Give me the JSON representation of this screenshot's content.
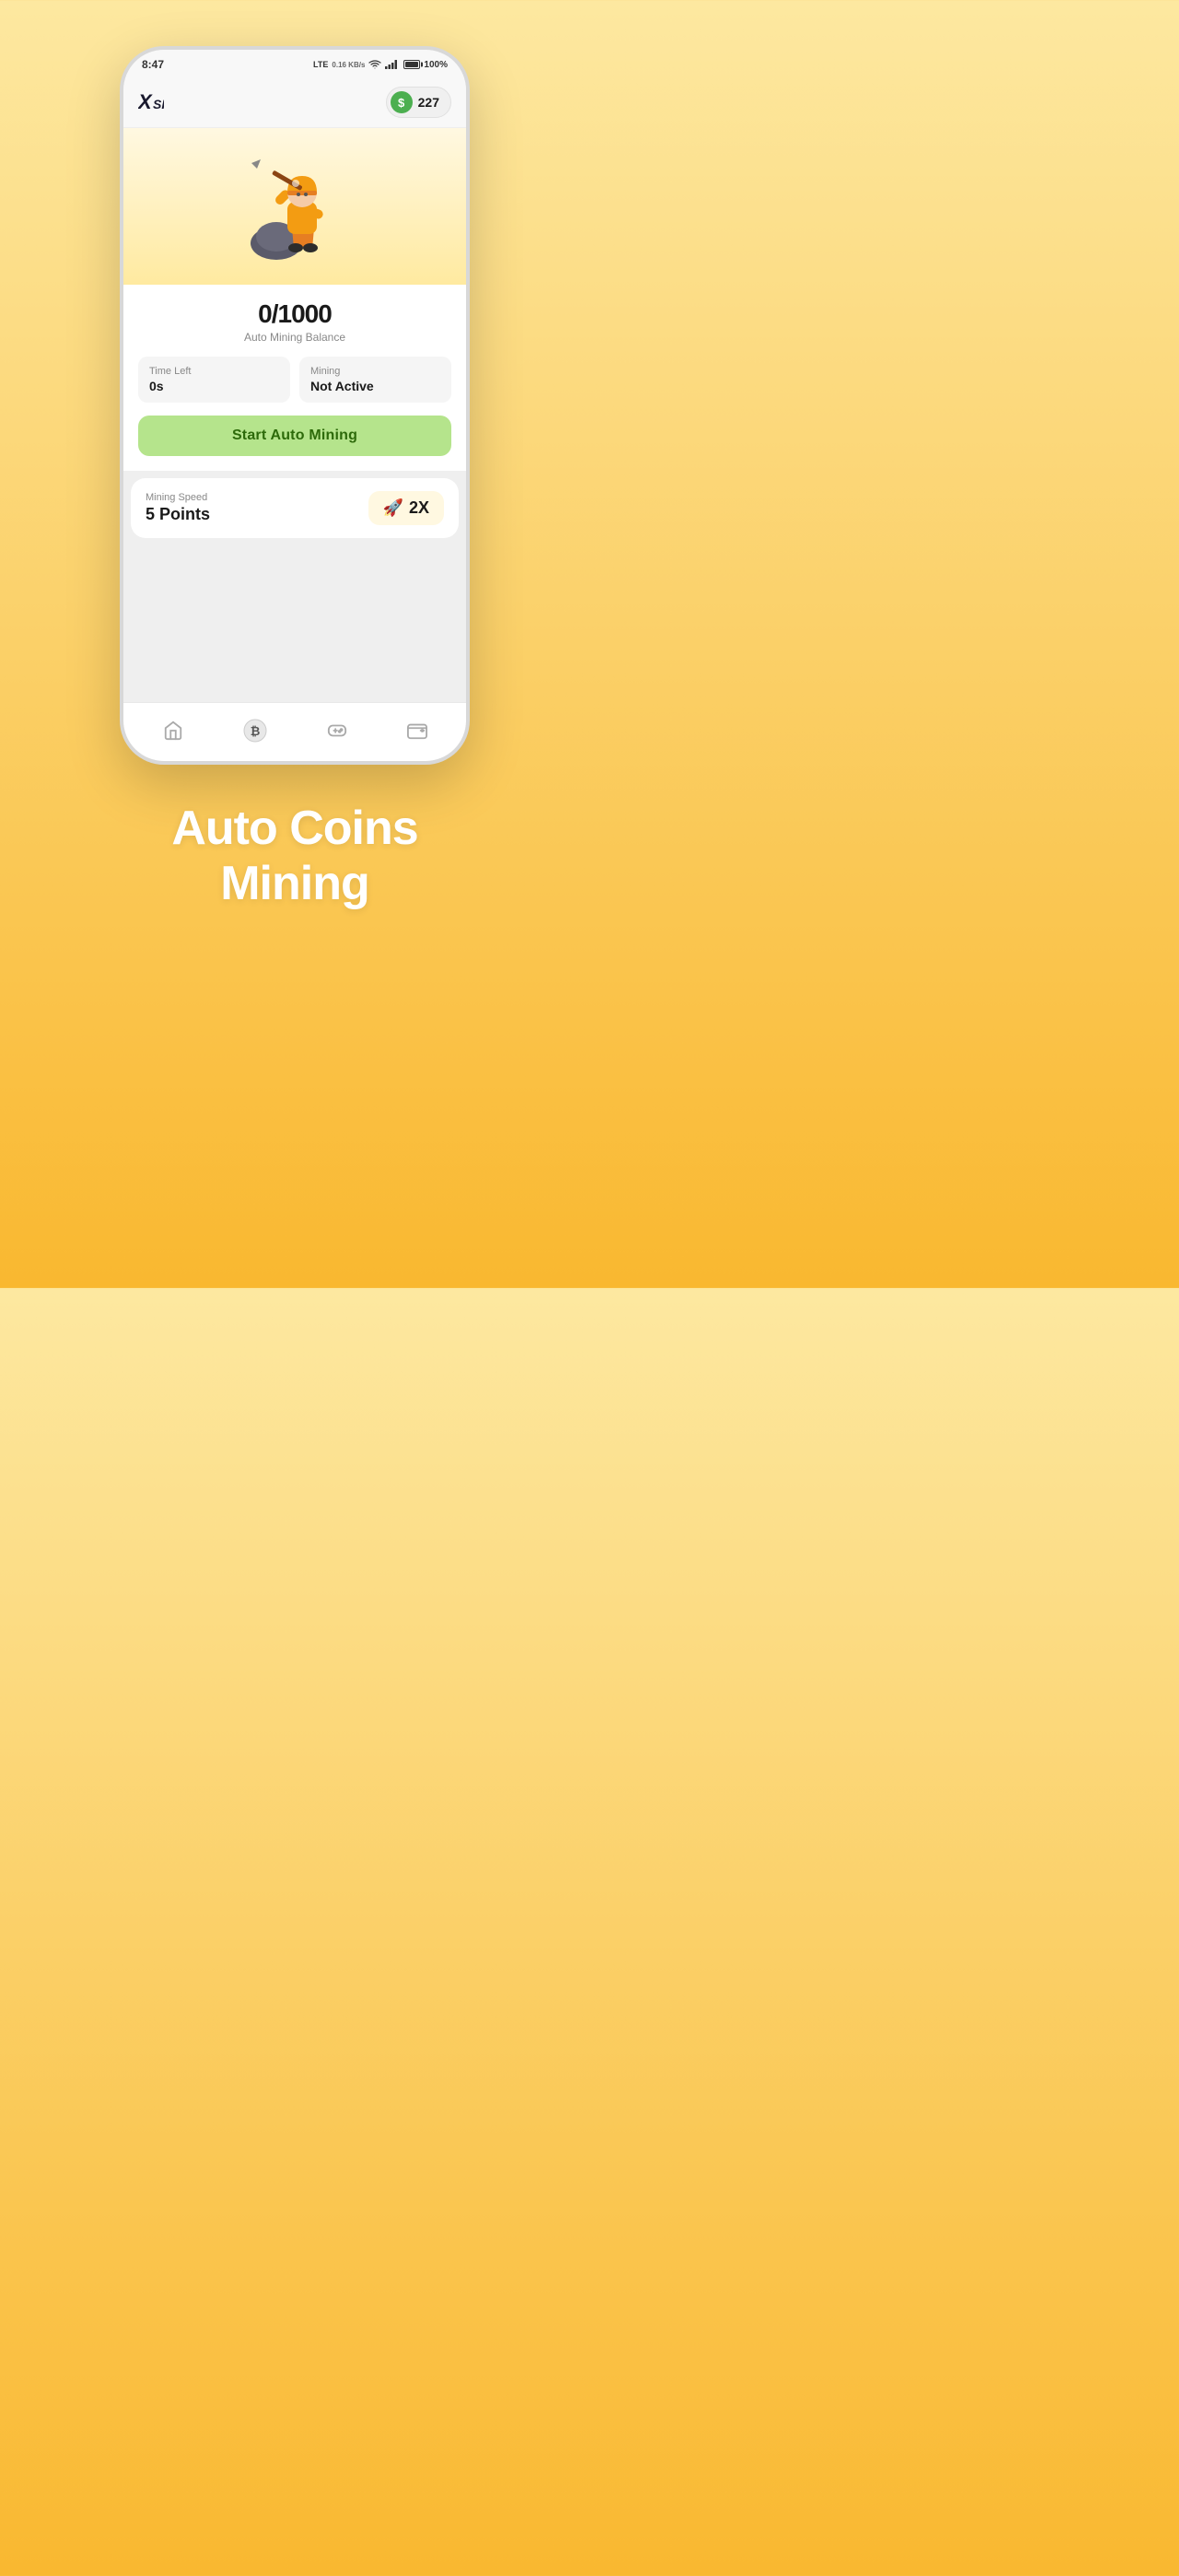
{
  "statusBar": {
    "time": "8:47",
    "network": "LTE",
    "speed": "0.16 KB/s",
    "battery": "100%"
  },
  "header": {
    "logoText": "XSINO",
    "balanceAmount": "227"
  },
  "miningSection": {
    "balanceDisplay": "0/1000",
    "balanceLabel": "Auto Mining Balance",
    "timeLeftLabel": "Time Left",
    "timeLeftValue": "0s",
    "miningLabel": "Mining",
    "miningStatus": "Not Active",
    "startButtonLabel": "Start Auto Mining"
  },
  "speedSection": {
    "speedLabel": "Mining Speed",
    "speedValue": "5 Points",
    "boostLabel": "2X"
  },
  "bottomNav": {
    "items": [
      {
        "id": "home",
        "icon": "🏠",
        "active": false
      },
      {
        "id": "mining",
        "icon": "₿",
        "active": true
      },
      {
        "id": "games",
        "icon": "🎮",
        "active": false
      },
      {
        "id": "wallet",
        "icon": "👛",
        "active": false
      }
    ]
  },
  "tagline": {
    "line1": "Auto Coins",
    "line2": "Mining"
  }
}
